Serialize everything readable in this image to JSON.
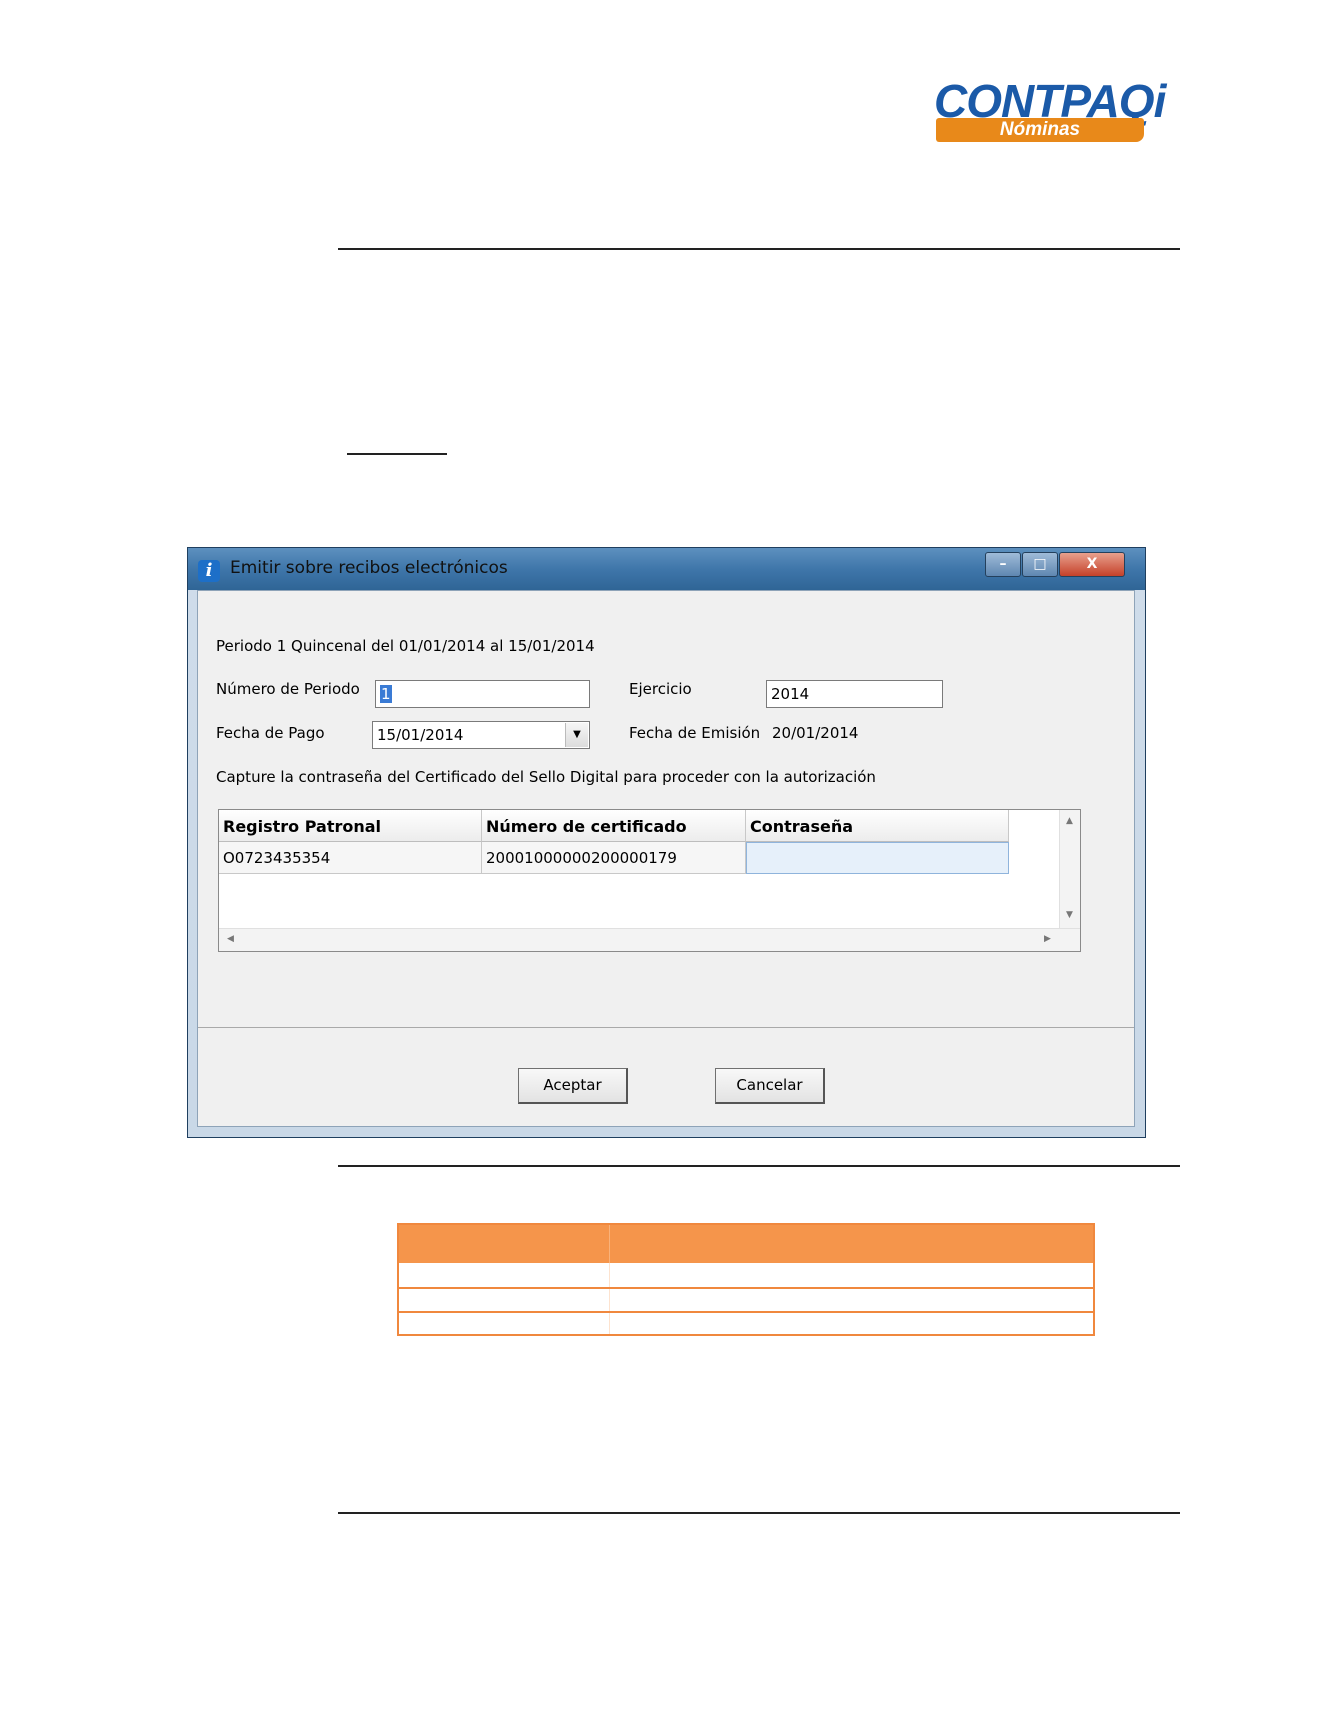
{
  "logo": {
    "brand": "CONTPAQ",
    "brand_i": "i",
    "product": "Nóminas"
  },
  "window": {
    "title": "Emitir sobre recibos electrónicos",
    "period_text": "Periodo 1  Quincenal del 01/01/2014 al 15/01/2014",
    "numero_periodo_label": "Número de Periodo",
    "numero_periodo_value": "1",
    "ejercicio_label": "Ejercicio",
    "ejercicio_value": "2014",
    "fecha_pago_label": "Fecha de Pago",
    "fecha_pago_value": "15/01/2014",
    "fecha_emision_label": "Fecha de Emisión",
    "fecha_emision_value": "20/01/2014",
    "instruction": "Capture la contraseña del Certificado del Sello Digital para proceder con la autorización",
    "grid": {
      "headers": [
        "Registro Patronal",
        "Número de certificado",
        "Contraseña"
      ],
      "rows": [
        [
          "O0723435354",
          "20001000000200000179",
          ""
        ]
      ]
    },
    "buttons": {
      "accept": "Aceptar",
      "cancel": "Cancelar"
    },
    "controls": {
      "minimize": "–",
      "maximize": "□",
      "close": "X"
    }
  },
  "colors": {
    "logo_blue": "#1b5aa8",
    "logo_orange": "#e8891a",
    "table_orange": "#f5954b",
    "title_bar": "#3f76aa"
  },
  "icons": [
    "info-icon",
    "minimize-icon",
    "maximize-icon",
    "close-icon",
    "dropdown-arrow-icon",
    "scroll-up-icon",
    "scroll-down-icon",
    "scroll-left-icon",
    "scroll-right-icon"
  ]
}
